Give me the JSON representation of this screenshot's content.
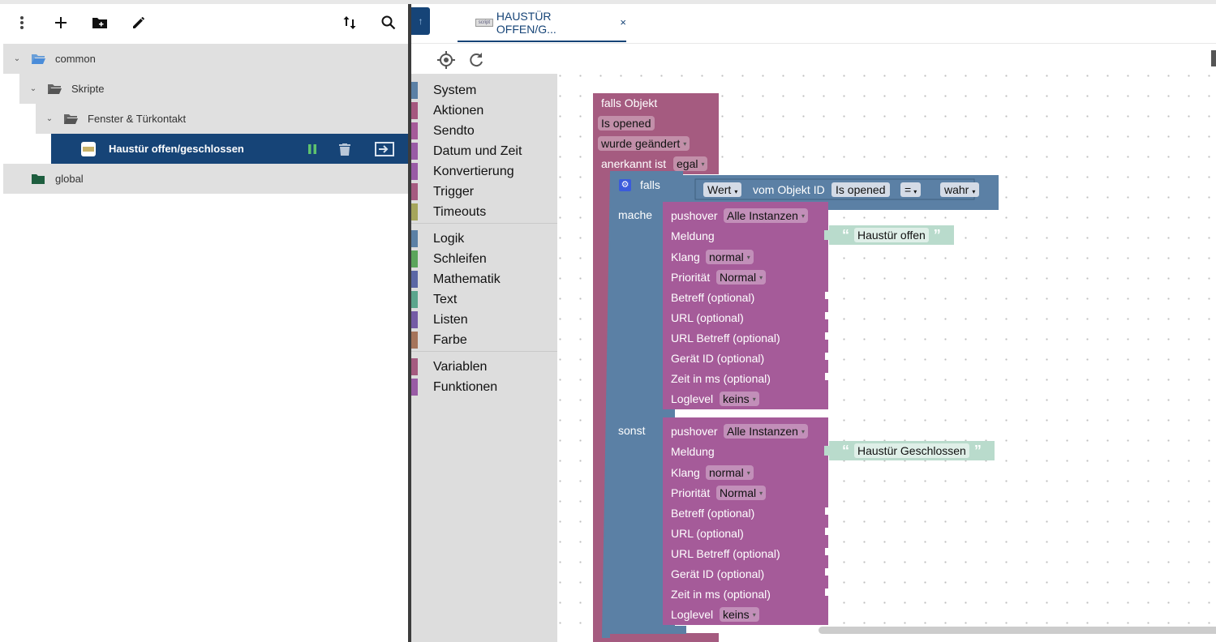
{
  "tree": {
    "toolbar": {
      "menu_icon": "more-vert-icon",
      "add_icon": "plus-icon",
      "add_folder_icon": "add-folder-icon",
      "edit_icon": "pencil-icon",
      "sort_icon": "sort-icon",
      "search_icon": "search-icon"
    },
    "nodes": [
      {
        "label": "common"
      },
      {
        "label": "Skripte"
      },
      {
        "label": "Fenster & Türkontakt"
      },
      {
        "label": "Haustür offen/geschlossen"
      },
      {
        "label": "global"
      }
    ]
  },
  "tab": {
    "title": "HAUSTÜR OFFEN/G...",
    "close": "×",
    "logo": "script"
  },
  "toolbox": {
    "categories": [
      {
        "label": "System",
        "color": "#5b80a5"
      },
      {
        "label": "Aktionen",
        "color": "#a5577f"
      },
      {
        "label": "Sendto",
        "color": "#a55b99"
      },
      {
        "label": "Datum und Zeit",
        "color": "#995ba5"
      },
      {
        "label": "Konvertierung",
        "color": "#995ba5"
      },
      {
        "label": "Trigger",
        "color": "#a55b80"
      },
      {
        "label": "Timeouts",
        "color": "#a5a55b"
      },
      {
        "label": "Logik",
        "color": "#5b80a5"
      },
      {
        "label": "Schleifen",
        "color": "#5ba55b"
      },
      {
        "label": "Mathematik",
        "color": "#5b67a5"
      },
      {
        "label": "Text",
        "color": "#5ba58c"
      },
      {
        "label": "Listen",
        "color": "#745ba5"
      },
      {
        "label": "Farbe",
        "color": "#a5745b"
      },
      {
        "label": "Variablen",
        "color": "#a55b80"
      },
      {
        "label": "Funktionen",
        "color": "#995ba5"
      }
    ]
  },
  "blocks": {
    "trigger": {
      "title": "falls Objekt",
      "object": "Is opened",
      "changed": "wurde geändert",
      "ack_label": "anerkannt ist",
      "ack_value": "egal"
    },
    "if": {
      "falls": "falls",
      "mache": "mache",
      "sonst": "sonst",
      "wert": "Wert",
      "vom_objekt": "vom Objekt ID",
      "object": "Is opened",
      "op": "=",
      "value": "wahr"
    },
    "push1": {
      "title": "pushover",
      "instance": "Alle Instanzen",
      "meldung": "Meldung",
      "message": "Haustür offen",
      "klang": "Klang",
      "klang_value": "normal",
      "prio": "Priorität",
      "prio_value": "Normal",
      "betreff": "Betreff (optional)",
      "url": "URL (optional)",
      "url_betreff": "URL Betreff (optional)",
      "geraet": "Gerät ID (optional)",
      "zeit": "Zeit in ms (optional)",
      "loglevel": "Loglevel",
      "loglevel_value": "keins"
    },
    "push2": {
      "title": "pushover",
      "instance": "Alle Instanzen",
      "meldung": "Meldung",
      "message": "Haustür Geschlossen",
      "klang": "Klang",
      "klang_value": "normal",
      "prio": "Priorität",
      "prio_value": "Normal",
      "betreff": "Betreff (optional)",
      "url": "URL (optional)",
      "url_betreff": "URL Betreff (optional)",
      "geraet": "Gerät ID (optional)",
      "zeit": "Zeit in ms (optional)",
      "loglevel": "Loglevel",
      "loglevel_value": "keins"
    }
  }
}
